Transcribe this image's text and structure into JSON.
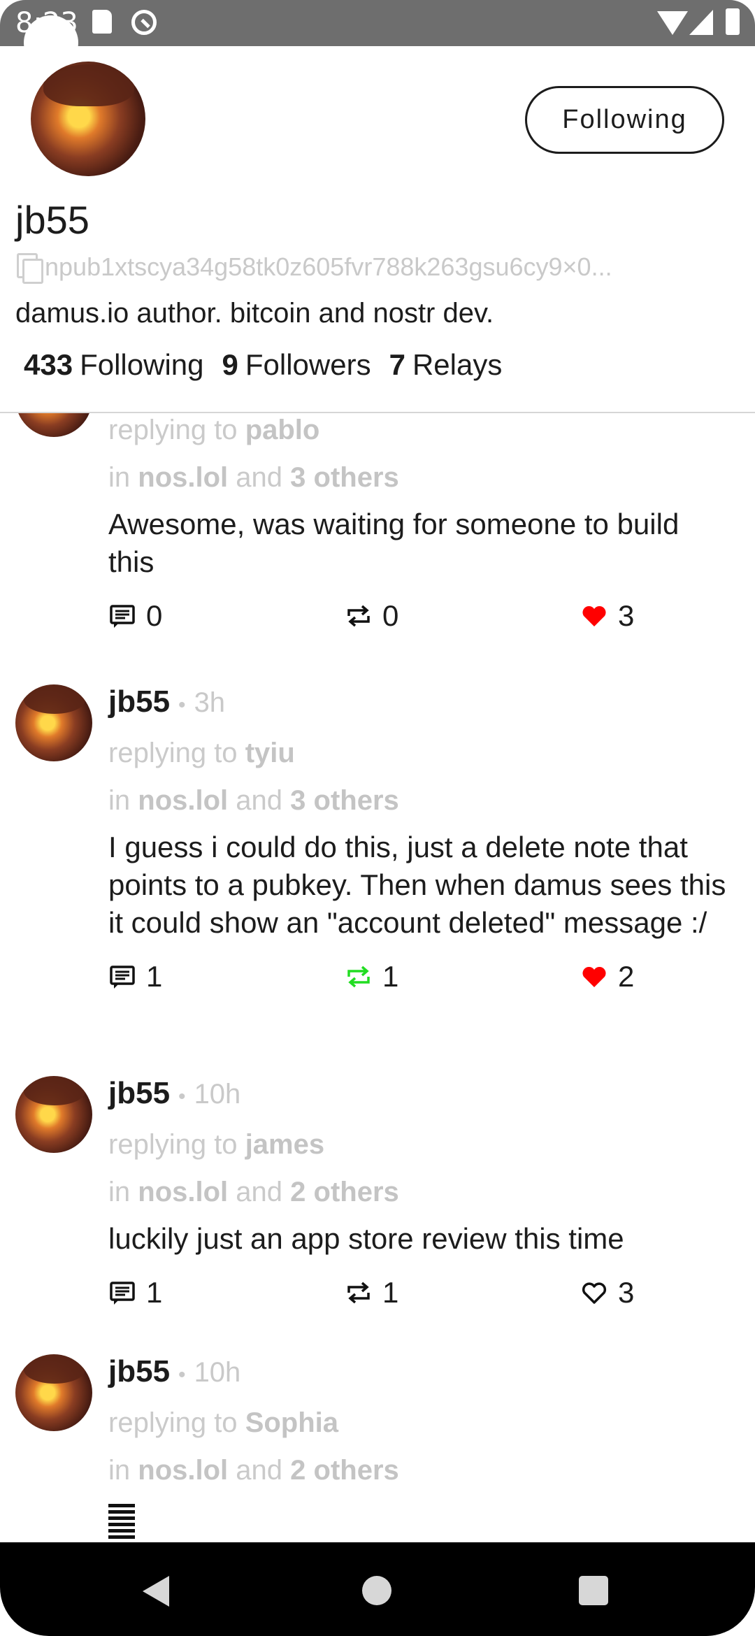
{
  "status_bar": {
    "time": "8:23"
  },
  "profile": {
    "display_name": "jb55",
    "npub": "npub1xtscya34g58tk0z605fvr788k263gsu6cy9×0...",
    "bio": "damus.io author. bitcoin and nostr dev.",
    "follow_button_label": "Following",
    "stats": {
      "following_count": "433",
      "following_label": "Following",
      "followers_count": "9",
      "followers_label": "Followers",
      "relays_count": "7",
      "relays_label": "Relays"
    }
  },
  "feed": {
    "posts": [
      {
        "author": "",
        "time": "",
        "replying_prefix": "replying to",
        "replying_to": "pablo",
        "in_prefix": "in",
        "relay": "nos.lol",
        "and_label": "and",
        "others": "3 others",
        "content": "Awesome, was waiting for someone to build this",
        "reply_count": "0",
        "repost_count": "0",
        "like_count": "3",
        "reposted": false,
        "liked": true
      },
      {
        "author": "jb55",
        "time": "3h",
        "replying_prefix": "replying to",
        "replying_to": "tyiu",
        "in_prefix": "in",
        "relay": "nos.lol",
        "and_label": "and",
        "others": "3 others",
        "content": "I guess i could do this, just a delete note that points to a pubkey. Then when damus sees this it could show an \"account deleted\" message :/",
        "reply_count": "1",
        "repost_count": "1",
        "like_count": "2",
        "reposted": true,
        "liked": true
      },
      {
        "author": "jb55",
        "time": "10h",
        "replying_prefix": "replying to",
        "replying_to": "james",
        "in_prefix": "in",
        "relay": "nos.lol",
        "and_label": "and",
        "others": "2 others",
        "content": "luckily just an app store review this time",
        "reply_count": "1",
        "repost_count": "1",
        "like_count": "3",
        "reposted": false,
        "liked": false
      },
      {
        "author": "jb55",
        "time": "10h",
        "replying_prefix": "replying to",
        "replying_to": "Sophia",
        "in_prefix": "in",
        "relay": "nos.lol",
        "and_label": "and",
        "others": "2 others"
      }
    ]
  },
  "colors": {
    "accent_like": "#ff0000",
    "accent_repost": "#22dd22",
    "muted_text": "#c9c9c9",
    "statusbar_bg": "#6e6e6e",
    "navbar_bg": "#000000"
  },
  "icons": {
    "reply": "reply-icon",
    "repost": "repost-icon",
    "like": "heart-icon",
    "copy": "copy-icon"
  }
}
